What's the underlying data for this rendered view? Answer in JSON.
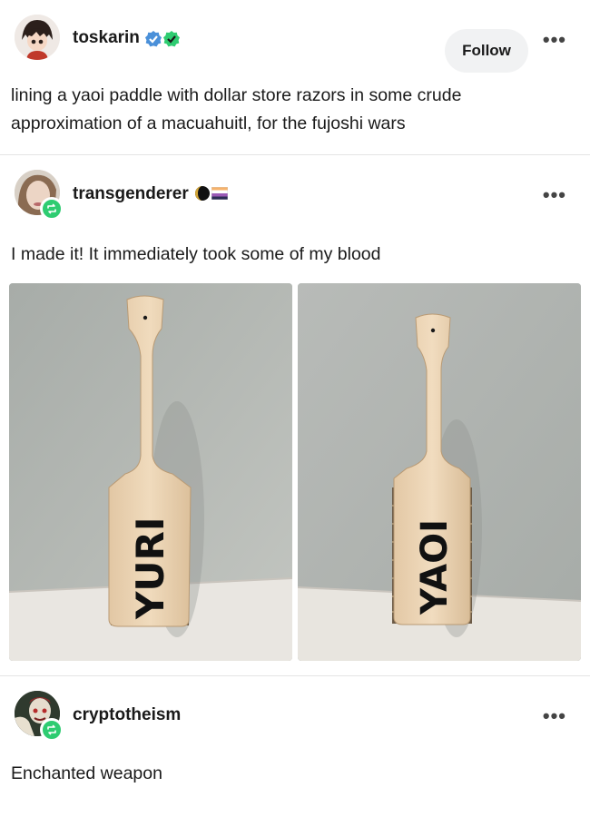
{
  "post1": {
    "username": "toskarin",
    "follow_label": "Follow",
    "more_label": "•••",
    "text_line1": "lining a yaoi paddle with dollar store razors in some crude",
    "text_line2": "approximation of a macuahuitl, for the fujoshi wars"
  },
  "post2": {
    "username": "transgenderer",
    "more_label": "•••",
    "text": "I made it! It immediately took some of my blood",
    "images": [
      {
        "paddle_text": "YURI"
      },
      {
        "paddle_text": "YAOI"
      }
    ]
  },
  "post3": {
    "username": "cryptotheism",
    "more_label": "•••",
    "text": "Enchanted weapon"
  },
  "colors": {
    "verified_blue": "#4a90d9",
    "verified_green": "#2ecc71",
    "reblog_green": "#2ecc71",
    "divider": "#e4e4e4"
  }
}
